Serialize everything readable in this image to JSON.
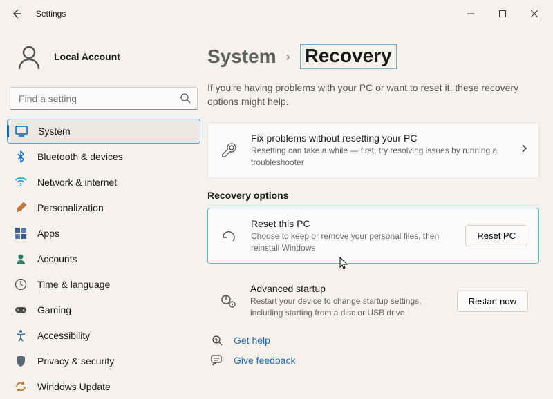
{
  "window": {
    "title": "Settings"
  },
  "account": {
    "name": "Local Account"
  },
  "search": {
    "placeholder": "Find a setting"
  },
  "nav": [
    {
      "label": "System"
    },
    {
      "label": "Bluetooth & devices"
    },
    {
      "label": "Network & internet"
    },
    {
      "label": "Personalization"
    },
    {
      "label": "Apps"
    },
    {
      "label": "Accounts"
    },
    {
      "label": "Time & language"
    },
    {
      "label": "Gaming"
    },
    {
      "label": "Accessibility"
    },
    {
      "label": "Privacy & security"
    },
    {
      "label": "Windows Update"
    }
  ],
  "breadcrumb": {
    "parent": "System",
    "current": "Recovery"
  },
  "intro": "If you're having problems with your PC or want to reset it, these recovery options might help.",
  "fix": {
    "title": "Fix problems without resetting your PC",
    "sub": "Resetting can take a while — first, try resolving issues by running a troubleshooter"
  },
  "section_header": "Recovery options",
  "reset": {
    "title": "Reset this PC",
    "sub": "Choose to keep or remove your personal files, then reinstall Windows",
    "button": "Reset PC"
  },
  "advanced": {
    "title": "Advanced startup",
    "sub": "Restart your device to change startup settings, including starting from a disc or USB drive",
    "button": "Restart now"
  },
  "help": {
    "get": "Get help",
    "feedback": "Give feedback"
  }
}
